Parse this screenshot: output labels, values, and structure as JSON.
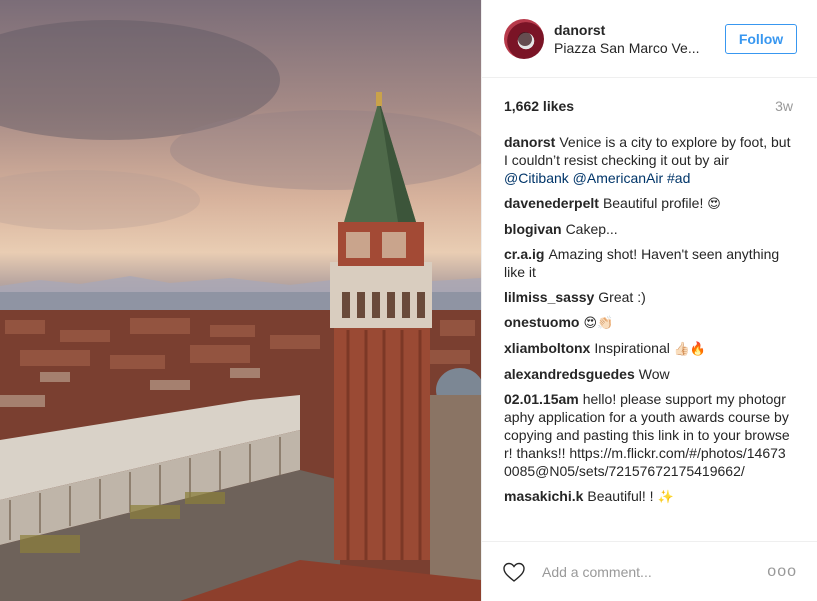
{
  "post": {
    "username": "danorst",
    "location": "Piazza San Marco Ve...",
    "follow_label": "Follow",
    "likes": "1,662 likes",
    "age": "3w",
    "caption": {
      "author": "danorst",
      "text": "Venice is a city to explore by foot, but I couldn’t resist checking it out by air",
      "tags": "@Citibank @AmericanAir #ad"
    }
  },
  "comments": [
    {
      "author": "davenederpelt",
      "text": "Beautiful profile!",
      "emoji": "😍"
    },
    {
      "author": "blogivan",
      "text": "Cakep...",
      "emoji": ""
    },
    {
      "author": "cr.a.ig",
      "text": "Amazing shot! Haven't seen anything like it",
      "emoji": ""
    },
    {
      "author": "lilmiss_sassy",
      "text": "Great :)",
      "emoji": ""
    },
    {
      "author": "onestuomo",
      "text": "",
      "emoji": "😍👏🏻"
    },
    {
      "author": "xliamboltonx",
      "text": "Inspirational",
      "emoji": "👍🏻🔥"
    },
    {
      "author": "alexandredsguedes",
      "text": "Wow",
      "emoji": ""
    },
    {
      "author": "02.01.15am",
      "text": "hello! please support my photography application for a youth awards course by copying and pasting this link in to your browser! thanks!! https://m.flickr.com/#/photos/146730085@N05/sets/72157672175419662/",
      "emoji": ""
    },
    {
      "author": "masakichi.k",
      "text": "Beautiful! !",
      "emoji": "✨"
    }
  ],
  "footer": {
    "comment_placeholder": "Add a comment...",
    "more_label": "ooo"
  },
  "icons": {
    "like": "heart-outline-icon",
    "more": "more-options-icon"
  },
  "colors": {
    "accent": "#3897f0",
    "tag": "#003569",
    "muted": "#999999"
  }
}
